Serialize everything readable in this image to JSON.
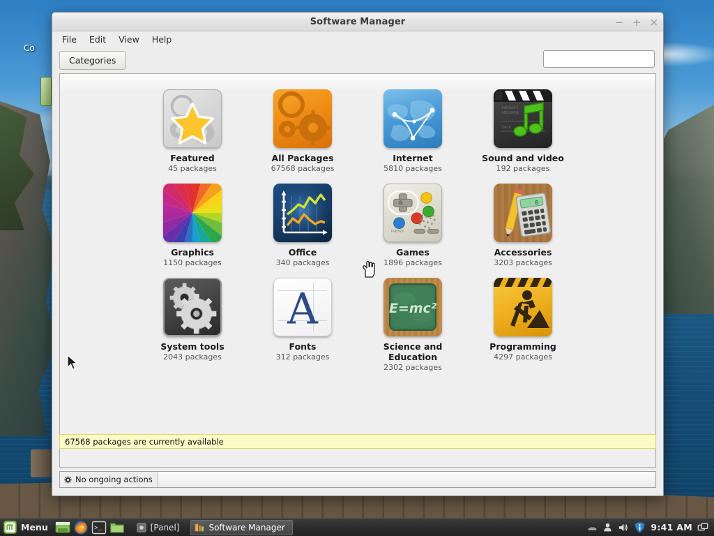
{
  "window": {
    "title": "Software Manager",
    "controls": {
      "minimize": "−",
      "maximize": "+",
      "close": "×"
    },
    "menus": [
      "File",
      "Edit",
      "View",
      "Help"
    ],
    "toolbar": {
      "categories_label": "Categories"
    },
    "search": {
      "value": "",
      "placeholder": ""
    },
    "status_message": "67568 packages are currently available",
    "bottom": {
      "ongoing_label": "No ongoing actions",
      "progress_percent": 0
    }
  },
  "categories": [
    {
      "name": "Featured",
      "count": "45 packages",
      "icon": "featured-icon"
    },
    {
      "name": "All Packages",
      "count": "67568 packages",
      "icon": "all-packages-icon"
    },
    {
      "name": "Internet",
      "count": "5810 packages",
      "icon": "internet-icon"
    },
    {
      "name": "Sound and video",
      "count": "192 packages",
      "icon": "sound-and-video-icon"
    },
    {
      "name": "Graphics",
      "count": "1150 packages",
      "icon": "graphics-icon"
    },
    {
      "name": "Office",
      "count": "340 packages",
      "icon": "office-icon"
    },
    {
      "name": "Games",
      "count": "1896 packages",
      "icon": "games-icon"
    },
    {
      "name": "Accessories",
      "count": "3203 packages",
      "icon": "accessories-icon"
    },
    {
      "name": "System tools",
      "count": "2043 packages",
      "icon": "system-tools-icon"
    },
    {
      "name": "Fonts",
      "count": "312 packages",
      "icon": "fonts-icon"
    },
    {
      "name": "Science and Education",
      "count": "2302 packages",
      "icon": "science-education-icon"
    },
    {
      "name": "Programming",
      "count": "4297 packages",
      "icon": "programming-icon"
    }
  ],
  "desktop": {
    "icons": [
      {
        "label": "Co"
      }
    ]
  },
  "taskbar": {
    "menu_label": "Menu",
    "launchers": [
      "show-desktop-icon",
      "firefox-icon",
      "terminal-icon",
      "file-manager-icon"
    ],
    "tasks": [
      {
        "label": "[Panel]",
        "active": false,
        "icon": "panel-icon"
      },
      {
        "label": "Software Manager",
        "active": true,
        "icon": "software-manager-icon"
      }
    ],
    "tray": [
      "keyboard-icon",
      "user-icon",
      "volume-icon",
      "update-shield-icon"
    ],
    "clock": "9:41 AM",
    "workspace_icon": "workspace-switcher-icon"
  },
  "colors": {
    "accent_orange": "#ef8d14",
    "status_yellow": "#fbfbc8",
    "window_bg": "#ededed",
    "taskbar_bg": "#2c2c2c"
  }
}
